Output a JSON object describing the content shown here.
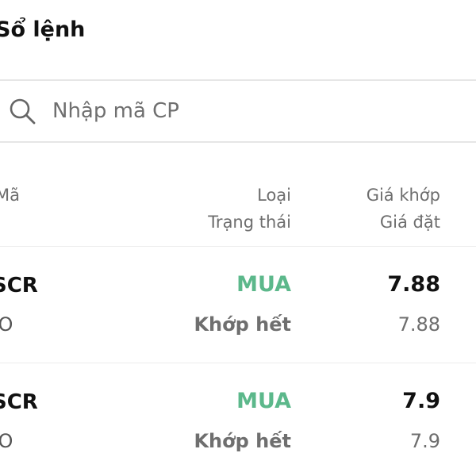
{
  "header": {
    "title": "Sổ lệnh"
  },
  "search": {
    "placeholder": "Nhập mã CP",
    "value": ""
  },
  "table": {
    "columns": {
      "symbol": "Mã",
      "type": "Loại",
      "status": "Trạng thái",
      "matched_price": "Giá khớp",
      "placed_price": "Giá đặt"
    },
    "rows": [
      {
        "symbol": "SCR",
        "order_type": "LO",
        "side": "MUA",
        "status": "Khớp hết",
        "matched_price": "7.88",
        "placed_price": "7.88"
      },
      {
        "symbol": "SCR",
        "order_type": "LO",
        "side": "MUA",
        "status": "Khớp hết",
        "matched_price": "7.9",
        "placed_price": "7.9"
      }
    ]
  },
  "colors": {
    "buy": "#5cb88b",
    "divider": "#ececec",
    "muted_text": "#6e6e6e"
  }
}
